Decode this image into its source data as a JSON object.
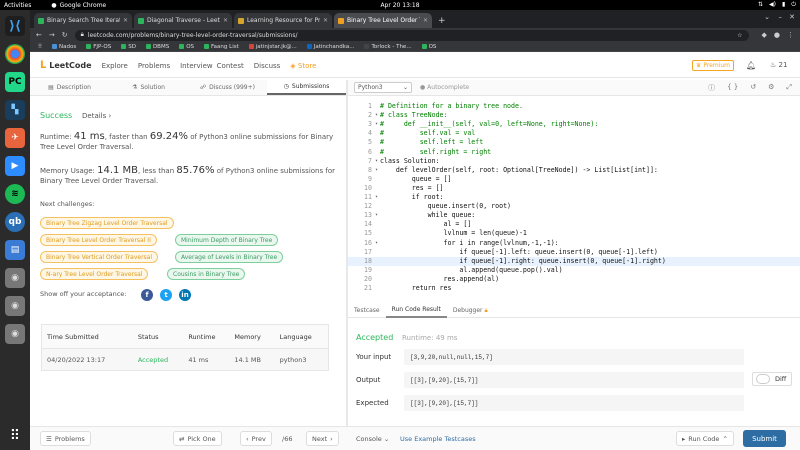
{
  "system": {
    "activities": "Activities",
    "active_app": "Google Chrome",
    "clock": "Apr 20  13:18"
  },
  "browser": {
    "tabs": [
      {
        "title": "Binary Search Tree Iterat",
        "color": "#2db55d"
      },
      {
        "title": "Diagonal Traverse - Leetc",
        "color": "#2db55d"
      },
      {
        "title": "Learning Resource for Pr",
        "color": "#d4a72c"
      },
      {
        "title": "Binary Tree Level Order T",
        "color": "#f0a020"
      }
    ],
    "url": "leetcode.com/problems/binary-tree-level-order-traversal/submissions/",
    "bookmarks": [
      {
        "label": "Nados",
        "color": "#4a90d9"
      },
      {
        "label": "FJP-OS",
        "color": "#2db55d"
      },
      {
        "label": "SD",
        "color": "#2db55d"
      },
      {
        "label": "DBMS",
        "color": "#2db55d"
      },
      {
        "label": "OS",
        "color": "#2db55d"
      },
      {
        "label": "Faang List",
        "color": "#2db55d"
      },
      {
        "label": "jatinjstar.jk@...",
        "color": "#d44638"
      },
      {
        "label": "Jatinchandka...",
        "color": "#0a66c2"
      },
      {
        "label": "Torlock - The...",
        "color": "#444"
      },
      {
        "label": "OS",
        "color": "#2db55d"
      }
    ]
  },
  "lc_nav": {
    "logo": "LeetCode",
    "items": [
      "Explore",
      "Problems",
      "Interview",
      "Contest",
      "Discuss",
      "Store"
    ],
    "premium": "Premium",
    "points": "21"
  },
  "left_tabs": [
    "Description",
    "Solution",
    "Discuss (999+)",
    "Submissions"
  ],
  "submission": {
    "status": "Success",
    "details": "Details",
    "runtime_prefix": "Runtime: ",
    "runtime": "41 ms",
    "runtime_mid": ", faster than ",
    "runtime_pct": "69.24%",
    "runtime_suffix": " of Python3 online submissions for Binary Tree Level Order Traversal.",
    "memory_prefix": "Memory Usage: ",
    "memory": "14.1 MB",
    "memory_mid": ", less than ",
    "memory_pct": "85.76%",
    "memory_suffix": " of Python3 online submissions for Binary Tree Level Order Traversal.",
    "next_label": "Next challenges:",
    "challenges": [
      {
        "title": "Binary Tree Zigzag Level Order Traversal",
        "level": "med"
      },
      {
        "title": "Binary Tree Level Order Traversal II",
        "level": "med"
      },
      {
        "title": "Minimum Depth of Binary Tree",
        "level": "easy"
      },
      {
        "title": "Binary Tree Vertical Order Traversal",
        "level": "med"
      },
      {
        "title": "Average of Levels in Binary Tree",
        "level": "easy"
      },
      {
        "title": "N-ary Tree Level Order Traversal",
        "level": "med"
      },
      {
        "title": "Cousins in Binary Tree",
        "level": "easy"
      }
    ],
    "showoff": "Show off your acceptance:",
    "table_headers": [
      "Time Submitted",
      "Status",
      "Runtime",
      "Memory",
      "Language"
    ],
    "table_row": [
      "04/20/2022 13:17",
      "Accepted",
      "41 ms",
      "14.1 MB",
      "python3"
    ]
  },
  "editor": {
    "language": "Python3",
    "autocomplete": "Autocomplete",
    "lines": [
      "# Definition for a binary tree node.",
      "# class TreeNode:",
      "#     def __init__(self, val=0, left=None, right=None):",
      "#         self.val = val",
      "#         self.left = left",
      "#         self.right = right",
      "class Solution:",
      "    def levelOrder(self, root: Optional[TreeNode]) -> List[List[int]]:",
      "        queue = []",
      "        res = []",
      "        if root:",
      "            queue.insert(0, root)",
      "            while queue:",
      "                al = []",
      "                lvlnum = len(queue)-1",
      "                for i in range(lvlnum,-1,-1):",
      "                    if queue[-1].left: queue.insert(0, queue[-1].left)",
      "                    if queue[-1].right: queue.insert(0, queue[-1].right)",
      "                    al.append(queue.pop().val)",
      "                res.append(al)",
      "        return res"
    ]
  },
  "console_tabs": [
    "Testcase",
    "Run Code Result",
    "Debugger"
  ],
  "result": {
    "status": "Accepted",
    "runtime": "Runtime: 49 ms",
    "input_label": "Your input",
    "input": "[3,9,20,null,null,15,7]",
    "output_label": "Output",
    "output": "[[3],[9,20],[15,7]]",
    "diff": "Diff",
    "expected_label": "Expected",
    "expected": "[[3],[9,20],[15,7]]"
  },
  "bottom": {
    "problems": "Problems",
    "pick_one": "Pick One",
    "prev": "Prev",
    "page": "/66",
    "next": "Next",
    "console": "Console",
    "example": "Use Example Testcases",
    "run": "Run Code",
    "submit": "Submit"
  }
}
